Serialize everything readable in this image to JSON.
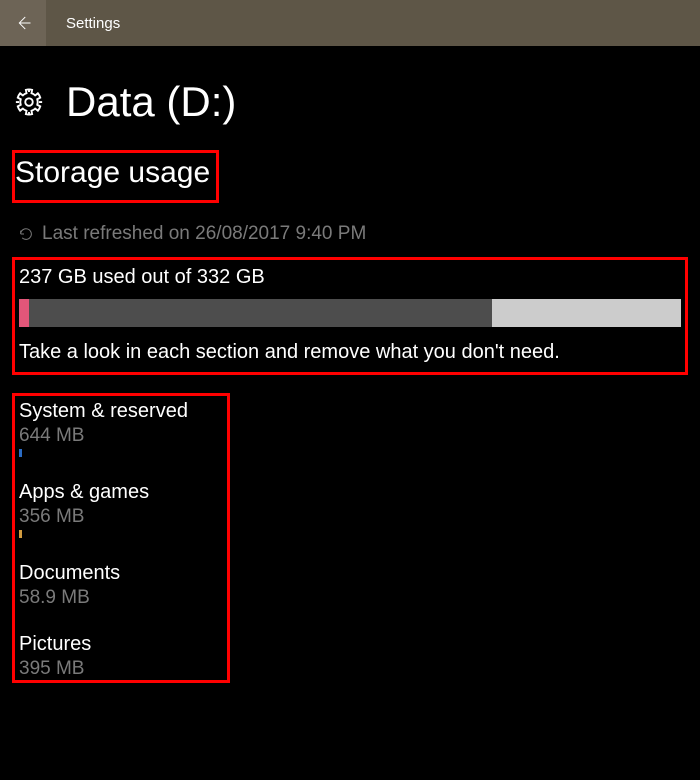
{
  "titlebar": {
    "title": "Settings"
  },
  "page": {
    "title": "Data (D:)"
  },
  "section": {
    "heading": "Storage usage"
  },
  "refresh": {
    "text": "Last refreshed on 26/08/2017 9:40 PM"
  },
  "usage": {
    "summary": "237 GB used out of 332 GB",
    "hint": "Take a look in each section and remove what you don't need.",
    "accent_color": "#e25679",
    "used_color": "#4d4d4d",
    "free_color": "#cccccc",
    "accent_percent": 1.5,
    "used_percent": 70
  },
  "categories": [
    {
      "name": "System & reserved",
      "size": "644 MB"
    },
    {
      "name": "Apps & games",
      "size": "356 MB"
    },
    {
      "name": "Documents",
      "size": "58.9 MB"
    },
    {
      "name": "Pictures",
      "size": "395 MB"
    }
  ]
}
